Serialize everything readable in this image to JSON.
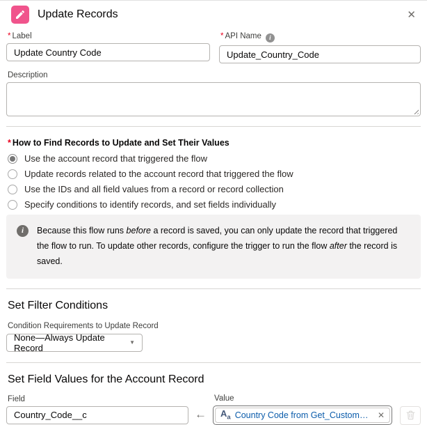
{
  "header": {
    "title": "Update Records",
    "icon": "update-records-pencil",
    "icon_color": "#f0548c",
    "close": "✕"
  },
  "form": {
    "label_field": {
      "label": "Label",
      "required": "*",
      "value": "Update Country Code"
    },
    "api_name_field": {
      "label": "API Name",
      "required": "*",
      "value": "Update_Country_Code",
      "info_icon": "i"
    },
    "description_field": {
      "label": "Description",
      "value": ""
    }
  },
  "how_to_find": {
    "heading": "How to Find Records to Update and Set Their Values",
    "required": "*",
    "options": [
      {
        "label": "Use the account record that triggered the flow",
        "selected": true
      },
      {
        "label": "Update records related to the account record that triggered the flow",
        "selected": false
      },
      {
        "label": "Use the IDs and all field values from a record or record collection",
        "selected": false
      },
      {
        "label": "Specify conditions to identify records, and set fields individually",
        "selected": false
      }
    ]
  },
  "info_banner": {
    "icon": "i",
    "part1": "Because this flow runs ",
    "italic1": "before",
    "part2": " a record is saved, you can only update the record that triggered the flow to run. To update other records, configure the trigger to run the flow ",
    "italic2": "after",
    "part3": " the record is saved."
  },
  "filter_section": {
    "heading": "Set Filter Conditions",
    "condition_label": "Condition Requirements to Update Record",
    "condition_value": "None—Always Update Record",
    "caret": "▼"
  },
  "field_values_section": {
    "heading": "Set Field Values for the Account Record",
    "field_label": "Field",
    "field_value": "Country_Code__c",
    "arrow": "←",
    "value_label": "Value",
    "value_type_icon_main": "A",
    "value_type_icon_sub": "a",
    "value_pill_text": "Country Code from Get_Custom_metadata > ...",
    "pill_remove": "✕"
  },
  "colors": {
    "accent_pink": "#f0548c",
    "link_blue": "#0b5cab",
    "required_red": "#ea001e",
    "banner_bg": "#f3f2f2",
    "border_gray": "#b5b3b0"
  }
}
